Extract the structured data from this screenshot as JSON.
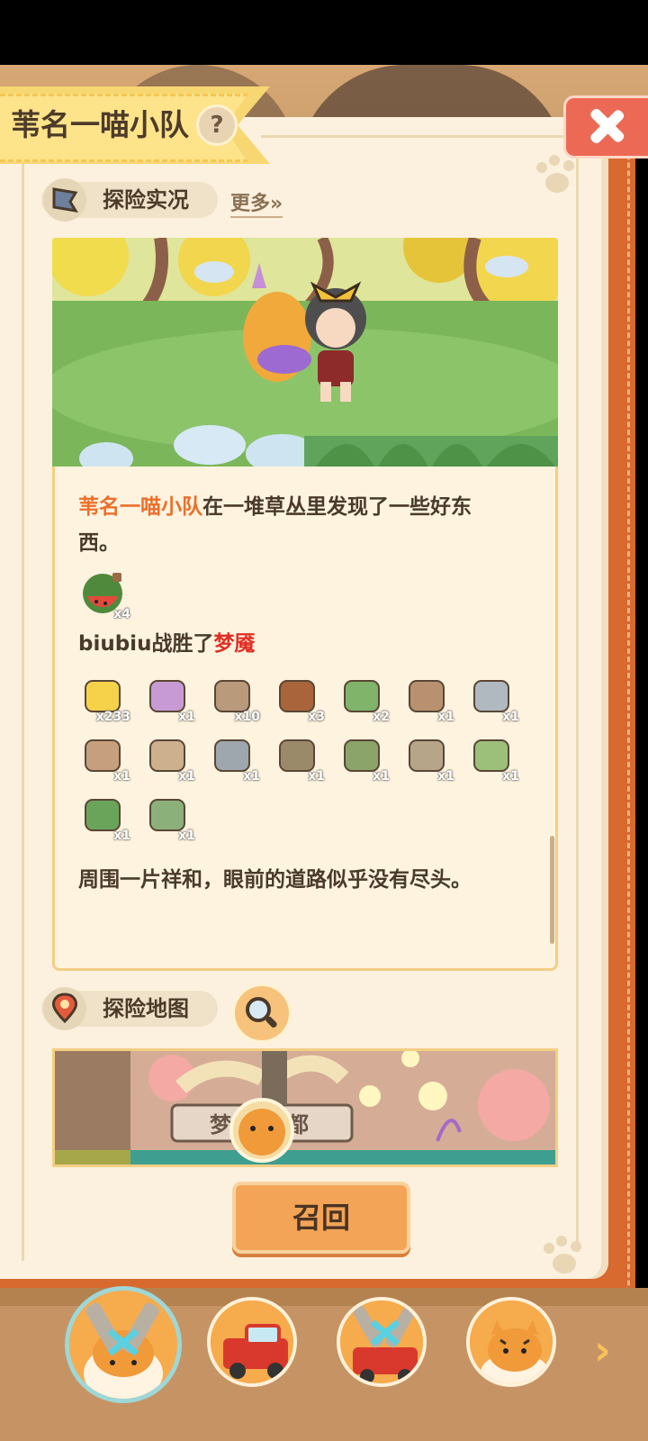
{
  "header": {
    "team_name": "苇名一喵小队",
    "help_symbol": "?"
  },
  "sections": {
    "live_label": "探险实况",
    "more_label": "更多»",
    "map_label": "探险地图"
  },
  "log": {
    "line1_team": "苇名一喵小队",
    "line1_rest": "在一堆草丛里发现了一些好东",
    "line1_cont": "西。",
    "found_items": [
      {
        "icon": "watermelon-icon",
        "qty": "x4"
      }
    ],
    "battle_actor": "biubiu",
    "battle_verb": "战胜了",
    "battle_enemy": "梦魇",
    "rewards": [
      {
        "icon": "banana-icon",
        "qty": "x233"
      },
      {
        "icon": "gacha-machine-icon",
        "qty": "x1"
      },
      {
        "icon": "cow-head-icon",
        "qty": "x10"
      },
      {
        "icon": "bear-cookie-icon",
        "qty": "x3"
      },
      {
        "icon": "grass-rug-icon",
        "qty": "x2"
      },
      {
        "icon": "lamp-box-icon",
        "qty": "x1"
      },
      {
        "icon": "glass-door-icon",
        "qty": "x1"
      },
      {
        "icon": "wood-plank-icon",
        "qty": "x1"
      },
      {
        "icon": "cardboard-box-icon",
        "qty": "x1"
      },
      {
        "icon": "pc-tower-icon",
        "qty": "x1"
      },
      {
        "icon": "tree-branch-icon",
        "qty": "x1"
      },
      {
        "icon": "stump-sprout-icon",
        "qty": "x1"
      },
      {
        "icon": "stone-arch-icon",
        "qty": "x1"
      },
      {
        "icon": "mossy-crate-icon",
        "qty": "x1"
      },
      {
        "icon": "vine-lamp-icon",
        "qty": "x1"
      },
      {
        "icon": "mossy-rock-icon",
        "qty": "x1"
      }
    ],
    "closing_line": "周围一片祥和，眼前的道路似乎没有尽头。"
  },
  "map": {
    "location_left": "梦",
    "location_right": "都"
  },
  "recall_label": "召回",
  "team_slots": [
    {
      "icon": "armored-tiger-icon"
    },
    {
      "icon": "red-truck-icon"
    },
    {
      "icon": "armored-tiger-truck-icon"
    },
    {
      "icon": "tiger-cub-icon"
    }
  ],
  "colors": {
    "accent_orange": "#ec6e2a",
    "enemy_red": "#e22d23",
    "book_cover": "#d8692f",
    "page_bg": "#fbf1de"
  }
}
